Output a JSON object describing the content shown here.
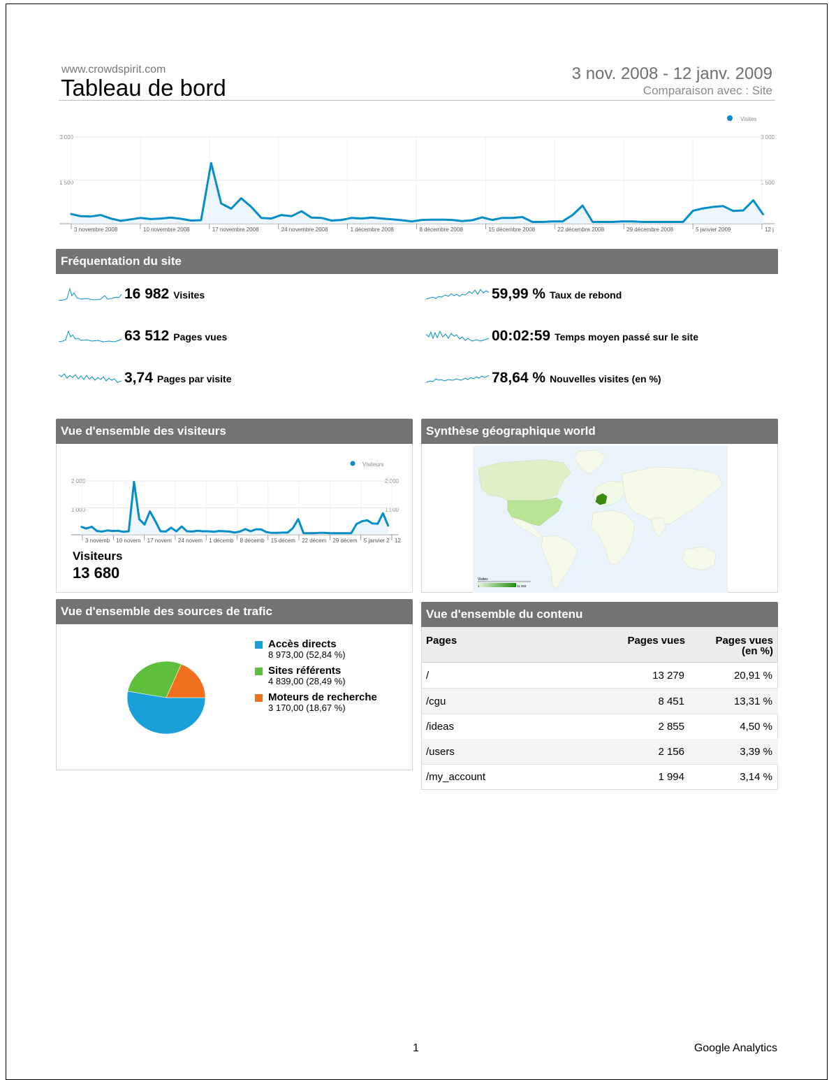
{
  "header": {
    "site": "www.crowdspirit.com",
    "title": "Tableau de bord",
    "date_range": "3 nov. 2008 - 12 janv. 2009",
    "comparison": "Comparaison avec : Site"
  },
  "colors": {
    "series": "#058dc7",
    "header_bg": "#737373",
    "pie_direct": "#1aa0d8",
    "pie_referral": "#5fbe3c",
    "pie_search": "#f0701e"
  },
  "main_chart": {
    "legend": "Visites",
    "y_ticks": [
      "3 000",
      "1 500"
    ],
    "y_ticks_right": [
      "3 000",
      "1 500"
    ],
    "x_labels": [
      "3 novembre 2008",
      "10 novembre 2008",
      "17 novembre 2008",
      "24 novembre 2008",
      "1 décembre 2008",
      "8 décembre 2008",
      "15 décembre 2008",
      "22 décembre 2008",
      "29 décembre 2008",
      "5 janvier 2009",
      "12 j"
    ]
  },
  "chart_data": [
    {
      "type": "line",
      "legend": "Visites",
      "ylim": [
        0,
        3000
      ],
      "y_ticks": [
        1500,
        3000
      ],
      "x_start": "2008-11-03",
      "x_end": "2009-01-12",
      "series": [
        {
          "name": "Visites",
          "values": [
            340,
            260,
            250,
            300,
            180,
            100,
            150,
            200,
            160,
            180,
            210,
            170,
            110,
            120,
            2100,
            700,
            520,
            880,
            580,
            200,
            180,
            300,
            260,
            430,
            210,
            200,
            110,
            130,
            200,
            180,
            210,
            180,
            150,
            120,
            80,
            130,
            140,
            140,
            130,
            90,
            120,
            220,
            130,
            200,
            200,
            230,
            60,
            60,
            80,
            80,
            300,
            630,
            60,
            60,
            60,
            80,
            80,
            60,
            60,
            60,
            60,
            60,
            450,
            530,
            580,
            610,
            440,
            460,
            810,
            310
          ]
        }
      ]
    },
    {
      "type": "line",
      "legend": "Visiteurs",
      "ylim": [
        0,
        2000
      ],
      "y_ticks": [
        1000,
        2000
      ],
      "x_start": "2008-11-03",
      "x_end": "2009-01-12",
      "series": [
        {
          "name": "Visiteurs",
          "values": [
            300,
            230,
            300,
            140,
            120,
            160,
            140,
            150,
            110,
            130,
            1970,
            580,
            380,
            870,
            520,
            130,
            120,
            260,
            130,
            310,
            130,
            120,
            150,
            130,
            130,
            110,
            140,
            130,
            120,
            80,
            120,
            210,
            130,
            200,
            200,
            100,
            70,
            70,
            80,
            80,
            250,
            580,
            60,
            60,
            60,
            70,
            70,
            60,
            60,
            60,
            60,
            60,
            400,
            500,
            540,
            420,
            410,
            800,
            320
          ]
        }
      ]
    },
    {
      "type": "pie",
      "categories": [
        "Accès directs",
        "Sites référents",
        "Moteurs de recherche"
      ],
      "values": [
        8973.0,
        4839.0,
        3170.0
      ],
      "percent": [
        52.84,
        28.49,
        18.67
      ]
    }
  ],
  "frequentation": {
    "title": "Fréquentation du site",
    "metrics": [
      {
        "value": "16 982",
        "label": "Visites"
      },
      {
        "value": "59,99 %",
        "label": "Taux de rebond"
      },
      {
        "value": "63 512",
        "label": "Pages vues"
      },
      {
        "value": "00:02:59",
        "label": "Temps moyen passé sur le site"
      },
      {
        "value": "3,74",
        "label": "Pages par visite"
      },
      {
        "value": "78,64 %",
        "label": "Nouvelles visites (en %)"
      }
    ]
  },
  "visitors": {
    "title": "Vue d'ensemble des visiteurs",
    "legend": "Visiteurs",
    "y_ticks": [
      "2 000",
      "1 000"
    ],
    "y_ticks_right": [
      "2 000",
      "1 000"
    ],
    "x_labels": [
      "3 novemb",
      "10 novem",
      "17 novem",
      "24 novem",
      "1 décemb",
      "8 décemb",
      "15 décem",
      "22 décem",
      "29 décem",
      "5 janvier 2",
      "12"
    ],
    "label": "Visiteurs",
    "value": "13 680"
  },
  "geo": {
    "title": "Synthèse géographique world",
    "scale_label": "Visites",
    "scale_min": "1",
    "scale_max": "11 293"
  },
  "traffic": {
    "title": "Vue d'ensemble des sources de trafic",
    "legend": [
      {
        "name": "Accès directs",
        "detail": "8 973,00 (52,84 %)"
      },
      {
        "name": "Sites référents",
        "detail": "4 839,00 (28,49 %)"
      },
      {
        "name": "Moteurs de recherche",
        "detail": "3 170,00 (18,67 %)"
      }
    ]
  },
  "content": {
    "title": "Vue d'ensemble du contenu",
    "col_pages": "Pages",
    "col_views": "Pages vues",
    "col_pct_1": "Pages vues",
    "col_pct_2": "(en %)",
    "rows": [
      {
        "page": "/",
        "views": "13 279",
        "pct": "20,91 %"
      },
      {
        "page": "/cgu",
        "views": "8 451",
        "pct": "13,31 %"
      },
      {
        "page": "/ideas",
        "views": "2 855",
        "pct": "4,50 %"
      },
      {
        "page": "/users",
        "views": "2 156",
        "pct": "3,39 %"
      },
      {
        "page": "/my_account",
        "views": "1 994",
        "pct": "3,14 %"
      }
    ]
  },
  "footer": {
    "page": "1",
    "brand": "Google Analytics"
  }
}
